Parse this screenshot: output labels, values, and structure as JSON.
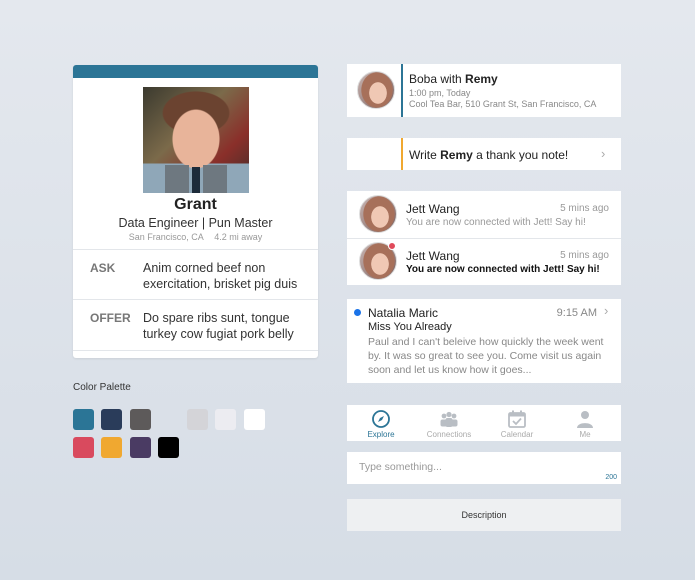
{
  "profile": {
    "name": "Grant",
    "title": "Data Engineer | Pun Master",
    "location": "San Francisco, CA",
    "distance": "4.2 mi away",
    "ask_label": "ASK",
    "ask_text": "Anim corned beef non exercitation, brisket pig duis",
    "offer_label": "OFFER",
    "offer_text": "Do spare ribs sunt, tongue turkey cow fugiat pork belly"
  },
  "palette": {
    "label": "Color Palette",
    "row1": [
      "#2b7596",
      "#2a3c5a",
      "#5d5a5a",
      "#d4d4d8",
      "#ececf1",
      "#ffffff"
    ],
    "row2": [
      "#d94a5e",
      "#f0a830",
      "#4a3b63",
      "#000000"
    ]
  },
  "event": {
    "title_prefix": "Boba with ",
    "title_name": "Remy",
    "time": "1:00 pm, Today",
    "place": "Cool Tea Bar, 510 Grant St, San Francisco, CA"
  },
  "note": {
    "prefix": "Write ",
    "name": "Remy",
    "suffix": " a thank you note!"
  },
  "messages": [
    {
      "name": "Jett Wang",
      "time": "5 mins ago",
      "text": "You are now connected with Jett! Say hi!"
    },
    {
      "name": "Jett Wang",
      "time": "5 mins ago",
      "text": "You are now connected with Jett! Say hi!"
    }
  ],
  "notification": {
    "name": "Natalia Maric",
    "time": "9:15 AM",
    "subject": "Miss You Already",
    "body": "Paul and I can't beleive how quickly the week went by. It was so great to see you. Come visit us again soon and let us know how it goes..."
  },
  "tabs": [
    {
      "label": "Explore",
      "icon": "compass-icon",
      "active": true
    },
    {
      "label": "Connections",
      "icon": "people-icon",
      "active": false
    },
    {
      "label": "Calendar",
      "icon": "calendar-icon",
      "active": false
    },
    {
      "label": "Me",
      "icon": "person-icon",
      "active": false
    }
  ],
  "input": {
    "placeholder": "Type something...",
    "counter": "200"
  },
  "description_button": "Description",
  "colors": {
    "accent": "#2c7596",
    "note_accent": "#f0a830",
    "unread": "#e04a5a",
    "notify": "#1a73e8"
  }
}
